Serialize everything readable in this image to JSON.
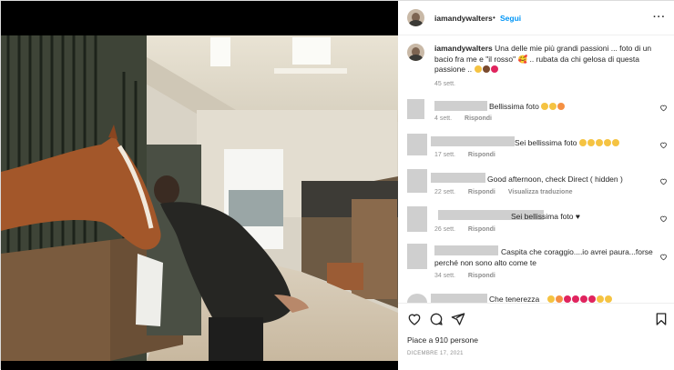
{
  "post": {
    "username": "iamandywalters",
    "separator": "•",
    "follow_label": "Segui",
    "more_label": "···",
    "caption": {
      "username": "iamandywalters",
      "text": "Una delle mie più grandi passioni ... foto di un bacio fra me e \"il rosso\" 🥰 .. rubata da chi gelosa di questa passione ..",
      "time": "45 sett."
    }
  },
  "comments": [
    {
      "text": "Bellissima foto",
      "time": "4 sett.",
      "reply": "Rispondi",
      "extra": "",
      "emoji_colors": [
        "#f5c342",
        "#f5c342",
        "#f59042"
      ]
    },
    {
      "text": "Sei bellissima foto",
      "time": "17 sett.",
      "reply": "Rispondi",
      "extra": "",
      "emoji_colors": [
        "#f5c342",
        "#f5c342",
        "#f5c342",
        "#f5c342",
        "#f5c342"
      ]
    },
    {
      "text": "Good afternoon, check Direct ( hidden )",
      "time": "22 sett.",
      "reply": "Rispondi",
      "extra": "Visualizza traduzione",
      "emoji_colors": []
    },
    {
      "text": "Sei bellissima foto ♥",
      "time": "26 sett.",
      "reply": "Rispondi",
      "extra": "",
      "emoji_colors": []
    },
    {
      "text": "Caspita che coraggio....io avrei paura...forse",
      "text2": "perché non sono alto come te",
      "time": "34 sett.",
      "reply": "Rispondi",
      "extra": "",
      "emoji_colors": []
    },
    {
      "text": "Che tenerezza",
      "time": "",
      "reply": "",
      "extra": "",
      "emoji_colors": [
        "#f5c342",
        "#f59042",
        "#e0245e",
        "#e0245e",
        "#e0245e",
        "#e0245e",
        "#f5c342",
        "#f5c342"
      ]
    }
  ],
  "footer": {
    "likes": "Piace a 910 persone",
    "date": "DICEMBRE 17, 2021"
  },
  "icons": {
    "like": "heart-icon",
    "comment": "comment-icon",
    "share": "paper-plane-icon",
    "save": "bookmark-icon"
  },
  "colors": {
    "accent": "#0095f6",
    "muted": "#8e8e8e",
    "text": "#262626"
  }
}
